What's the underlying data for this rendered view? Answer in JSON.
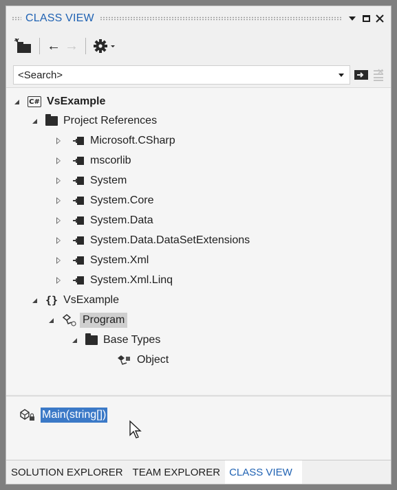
{
  "window": {
    "title": "CLASS VIEW"
  },
  "toolbar": {
    "items": [
      {
        "name": "new-folder-icon"
      },
      {
        "name": "back-arrow-icon"
      },
      {
        "name": "forward-arrow-icon"
      },
      {
        "name": "settings-gear-icon"
      }
    ]
  },
  "search": {
    "placeholder": "<Search>"
  },
  "tree": {
    "project": "VsExample",
    "references_folder": "Project References",
    "references": [
      "Microsoft.CSharp",
      "mscorlib",
      "System",
      "System.Core",
      "System.Data",
      "System.Data.DataSetExtensions",
      "System.Xml",
      "System.Xml.Linq"
    ],
    "namespace": "VsExample",
    "class": "Program",
    "base_types_folder": "Base Types",
    "base_type": "Object"
  },
  "members": {
    "items": [
      "Main(string[])"
    ]
  },
  "tabs": [
    {
      "label": "SOLUTION EXPLORER",
      "active": false
    },
    {
      "label": "TEAM EXPLORER",
      "active": false
    },
    {
      "label": "CLASS VIEW",
      "active": true
    }
  ],
  "colors": {
    "accent": "#1f62b3",
    "selection": "#3b79c7",
    "tree_selection": "#cfcfcf"
  }
}
